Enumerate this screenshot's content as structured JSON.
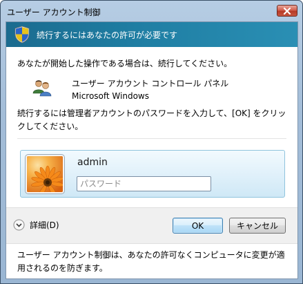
{
  "window": {
    "title": "ユーザー アカウント制御"
  },
  "banner": {
    "text": "続行するにはあなたの許可が必要です",
    "icon": "shield-icon",
    "color": "#1f7ea3"
  },
  "intro": "あなたが開始した操作である場合は、続行してください。",
  "program": {
    "name": "ユーザー アカウント コントロール パネル",
    "publisher": "Microsoft Windows",
    "icon": "users-icon"
  },
  "instruction": "続行するには管理者アカウントのパスワードを入力して、[OK] をクリックしてください。",
  "credential": {
    "username": "admin",
    "password_placeholder": "パスワード",
    "password_value": "",
    "picture": "flower-picture"
  },
  "buttons": {
    "details": "詳細(D)",
    "ok": "OK",
    "cancel": "キャンセル"
  },
  "footer": "ユーザー アカウント制御は、あなたの許可なくコンピュータに変更が適用されるのを防ぎます。"
}
